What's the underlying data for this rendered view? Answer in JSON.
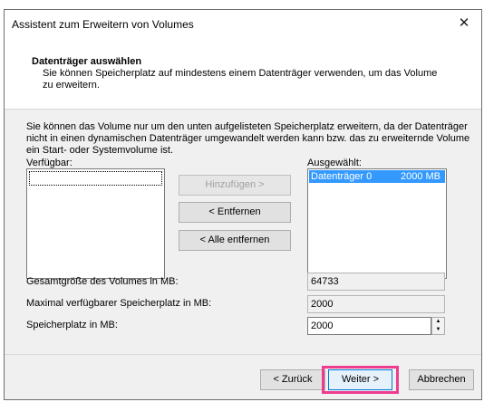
{
  "window": {
    "title": "Assistent zum Erweitern von Volumes",
    "close_glyph": "✕"
  },
  "header": {
    "title": "Datenträger auswählen",
    "description": "Sie können Speicherplatz auf mindestens einem Datenträger verwenden, um das Volume zu erweitern."
  },
  "info_text": "Sie können das Volume nur um den unten aufgelisteten Speicherplatz erweitern, da der Datenträger nicht in einen dynamischen Datenträger umgewandelt werden kann bzw. das zu erweiternde Volume ein Start- oder Systemvolume ist.",
  "available": {
    "label": "Verfügbar:",
    "items": []
  },
  "selected": {
    "label": "Ausgewählt:",
    "items": [
      {
        "name": "Datenträger 0",
        "size": "2000 MB"
      }
    ]
  },
  "buttons": {
    "add": "Hinzufügen >",
    "remove": "< Entfernen",
    "remove_all": "< Alle entfernen"
  },
  "fields": {
    "total_label": "Gesamtgröße des Volumes in MB:",
    "total_value": "64733",
    "max_label": "Maximal verfügbarer Speicherplatz in MB:",
    "max_value": "2000",
    "space_label": "Speicherplatz in MB:",
    "space_value": "2000"
  },
  "footer": {
    "back": "< Zurück",
    "next": "Weiter >",
    "cancel": "Abbrechen"
  },
  "colors": {
    "highlight": "#ee3d8e",
    "selection": "#3399ff"
  }
}
